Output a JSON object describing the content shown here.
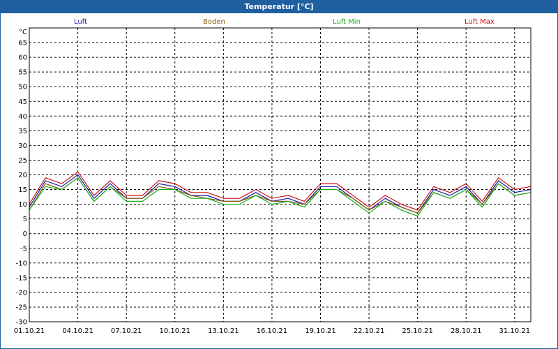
{
  "window": {
    "title": "Temperatur [°C]",
    "title_bg": "#1f5fa0"
  },
  "legend": [
    {
      "name": "Luft",
      "color": "#1a1aa8"
    },
    {
      "name": "Boden",
      "color": "#8b5a10"
    },
    {
      "name": "Luft Min",
      "color": "#19b019"
    },
    {
      "name": "Luft Max",
      "color": "#c81414"
    }
  ],
  "chart_data": {
    "type": "line",
    "title": "Temperatur [°C]",
    "ylabel": "°C",
    "xlabel": "",
    "ylim": [
      -30,
      70
    ],
    "y_ticks": [
      -30,
      -25,
      -20,
      -15,
      -10,
      -5,
      0,
      5,
      10,
      15,
      20,
      25,
      30,
      35,
      40,
      45,
      50,
      55,
      60,
      65
    ],
    "xlim": [
      "01.10.21",
      "01.11.21"
    ],
    "x_ticks": [
      "01.10.21",
      "04.10.21",
      "07.10.21",
      "10.10.21",
      "13.10.21",
      "16.10.21",
      "19.10.21",
      "22.10.21",
      "25.10.21",
      "28.10.21",
      "31.10.21"
    ],
    "grid": true,
    "legend_position": "top",
    "x": [
      "01.10.21",
      "02.10.21",
      "03.10.21",
      "04.10.21",
      "05.10.21",
      "06.10.21",
      "07.10.21",
      "08.10.21",
      "09.10.21",
      "10.10.21",
      "11.10.21",
      "12.10.21",
      "13.10.21",
      "14.10.21",
      "15.10.21",
      "16.10.21",
      "17.10.21",
      "18.10.21",
      "19.10.21",
      "20.10.21",
      "21.10.21",
      "22.10.21",
      "23.10.21",
      "24.10.21",
      "25.10.21",
      "26.10.21",
      "27.10.21",
      "28.10.21",
      "29.10.21",
      "30.10.21",
      "31.10.21",
      "01.11.21"
    ],
    "series": [
      {
        "name": "Luft",
        "color": "#1a1aa8",
        "values": [
          9,
          18,
          16,
          20,
          12,
          17,
          12,
          12,
          17,
          16,
          13,
          13,
          11,
          11,
          14,
          11,
          12,
          10,
          16,
          16,
          12,
          8,
          12,
          9,
          7,
          15,
          13,
          16,
          10,
          18,
          14,
          15
        ]
      },
      {
        "name": "Boden",
        "color": "#8b5a10",
        "values": [
          8,
          17,
          15,
          19,
          11,
          16,
          12,
          12,
          16,
          15,
          13,
          12,
          11,
          11,
          13,
          11,
          11,
          10,
          15,
          15,
          12,
          8,
          11,
          9,
          7,
          14,
          12,
          15,
          10,
          17,
          13,
          14
        ]
      },
      {
        "name": "Luft Min",
        "color": "#19b019",
        "values": [
          8,
          16,
          15,
          19,
          11,
          16,
          11,
          11,
          15,
          15,
          12,
          12,
          10,
          10,
          13,
          10,
          11,
          9,
          15,
          15,
          11,
          7,
          11,
          8,
          6,
          14,
          12,
          15,
          9,
          17,
          13,
          14
        ]
      },
      {
        "name": "Luft Max",
        "color": "#c81414",
        "values": [
          10,
          19,
          17,
          21,
          13,
          18,
          13,
          13,
          18,
          17,
          14,
          14,
          12,
          12,
          15,
          12,
          13,
          11,
          17,
          17,
          13,
          9,
          13,
          10,
          8,
          16,
          14,
          17,
          11,
          19,
          15,
          16
        ]
      }
    ]
  }
}
